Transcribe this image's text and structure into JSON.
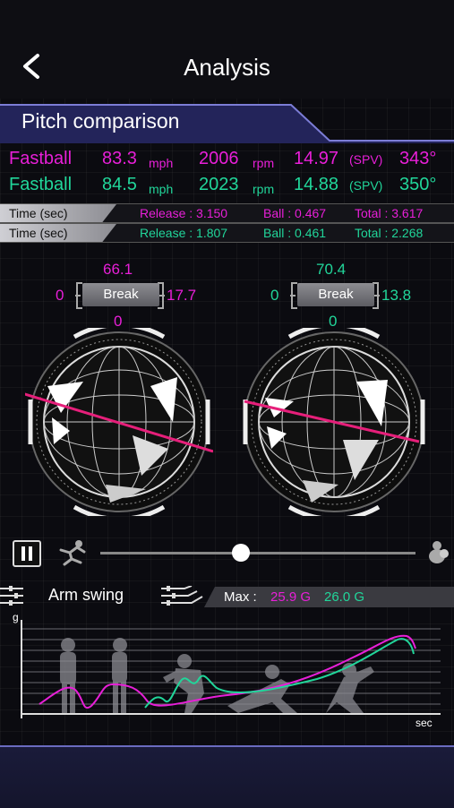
{
  "header": {
    "title": "Analysis",
    "back_icon": "chevron-left-icon"
  },
  "section": {
    "title": "Pitch comparison"
  },
  "pitches": [
    {
      "type": "Fastball",
      "speed": "83.3",
      "speed_unit": "mph",
      "spin": "2006",
      "spin_unit": "rpm",
      "spv": "14.97",
      "spv_unit": "(SPV)",
      "axis": "343°",
      "color": "#e81fd8"
    },
    {
      "type": "Fastball",
      "speed": "84.5",
      "speed_unit": "mph",
      "spin": "2023",
      "spin_unit": "rpm",
      "spv": "14.88",
      "spv_unit": "(SPV)",
      "axis": "350°",
      "color": "#21d69a"
    }
  ],
  "times": [
    {
      "label": "Time (sec)",
      "release": "Release : 3.150",
      "ball": "Ball : 0.467",
      "total": "Total : 3.617",
      "color": "#e81fd8"
    },
    {
      "label": "Time (sec)",
      "release": "Release : 1.807",
      "ball": "Ball : 0.461",
      "total": "Total : 2.268",
      "color": "#21d69a"
    }
  ],
  "breaks": [
    {
      "top": "66.1",
      "left": "0",
      "right": "17.7",
      "bottom": "0",
      "button": "Break",
      "color": "#e81fd8"
    },
    {
      "top": "70.4",
      "left": "0",
      "right": "13.8",
      "bottom": "0",
      "button": "Break",
      "color": "#21d69a"
    }
  ],
  "player": {
    "state": "paused",
    "position": 0.45,
    "start_icon": "pitcher-windup-icon",
    "end_icon": "catcher-icon"
  },
  "arm_swing": {
    "label": "Arm swing",
    "max_label": "Max :",
    "max_pink": "25.9 G",
    "max_green": "26.0 G",
    "y_axis": "g",
    "x_axis": "sec"
  }
}
